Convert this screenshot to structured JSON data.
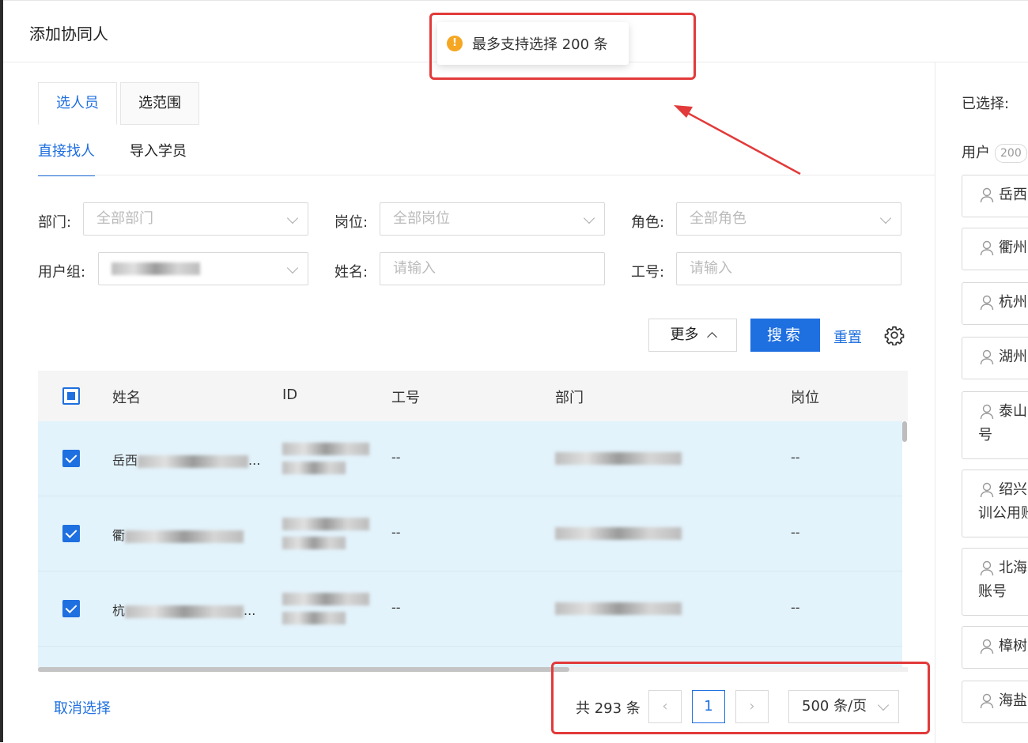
{
  "dialog": {
    "title": "添加协同人"
  },
  "toast": {
    "message": "最多支持选择 200 条"
  },
  "tabs": [
    {
      "label": "选人员"
    },
    {
      "label": "选范围"
    }
  ],
  "subtabs": [
    {
      "label": "直接找人"
    },
    {
      "label": "导入学员"
    }
  ],
  "filters": {
    "department": {
      "label": "部门",
      "placeholder": "全部部门"
    },
    "position": {
      "label": "岗位",
      "placeholder": "全部岗位"
    },
    "role": {
      "label": "角色",
      "placeholder": "全部角色"
    },
    "user_group": {
      "label": "用户组"
    },
    "name": {
      "label": "姓名",
      "placeholder": "请输入"
    },
    "employee_no": {
      "label": "工号",
      "placeholder": "请输入"
    }
  },
  "actions": {
    "more": "更多",
    "search": "搜索",
    "reset": "重置"
  },
  "table": {
    "columns": [
      "姓名",
      "ID",
      "工号",
      "部门",
      "岗位"
    ],
    "rows": [
      {
        "name_prefix": "岳西",
        "name_suffix": "...",
        "id": "",
        "emp_no": "--",
        "position": "--"
      },
      {
        "name_prefix": "衢",
        "name_suffix": "",
        "id": "",
        "emp_no": "--",
        "position": "--"
      },
      {
        "name_prefix": "杭",
        "name_suffix": "...",
        "id": "",
        "emp_no": "--",
        "position": "--"
      }
    ]
  },
  "footer": {
    "cancel": "取消选择",
    "total": "共 293 条",
    "current_page": "1",
    "page_size": "500 条/页"
  },
  "selected_panel": {
    "title": "已选择:",
    "users_label": "用户",
    "users_count": "200",
    "items": [
      {
        "line1": "岳西"
      },
      {
        "line1": "衢州"
      },
      {
        "line1": "杭州"
      },
      {
        "line1": "湖州"
      },
      {
        "line1": "泰山",
        "line2": "号"
      },
      {
        "line1": "绍兴",
        "line2": "训公用账"
      },
      {
        "line1": "北海",
        "line2": "账号"
      },
      {
        "line1": "樟树"
      },
      {
        "line1": "海盐"
      }
    ]
  },
  "colors": {
    "accent": "#1e6fe0",
    "selected_row": "#e3f3fb",
    "warning": "#f5a623",
    "highlight": "#e23a3a"
  }
}
